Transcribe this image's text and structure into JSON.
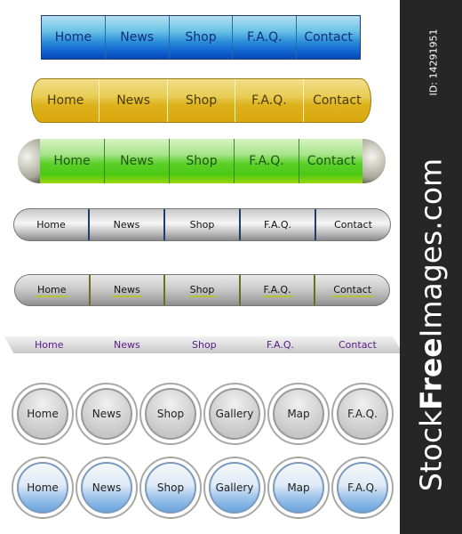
{
  "bars": {
    "blue": [
      "Home",
      "News",
      "Shop",
      "F.A.Q.",
      "Contact"
    ],
    "yellow": [
      "Home",
      "News",
      "Shop",
      "F.A.Q.",
      "Contact"
    ],
    "green": [
      "Home",
      "News",
      "Shop",
      "F.A.Q.",
      "Contact"
    ],
    "silver": [
      "Home",
      "News",
      "Shop",
      "F.A.Q.",
      "Contact"
    ],
    "grey": [
      "Home",
      "News",
      "Shop",
      "F.A.Q.",
      "Contact"
    ],
    "tabs": [
      "Home",
      "News",
      "Shop",
      "F.A.Q.",
      "Contact"
    ]
  },
  "circles": {
    "grey": [
      "Home",
      "News",
      "Shop",
      "Gallery",
      "Map",
      "F.A.Q."
    ],
    "blue": [
      "Home",
      "News",
      "Shop",
      "Gallery",
      "Map",
      "F.A.Q."
    ]
  },
  "watermark": {
    "brand_prefix": "Stock",
    "brand_bold": "Free",
    "brand_suffix": "Images.com",
    "id": "ID: 14291951"
  },
  "colors": {
    "blue_bar": "#0d5fd0",
    "yellow_bar": "#ddb21e",
    "green_bar": "#5cd02a",
    "tab_text": "#5a1a8a",
    "watermark_bg": "#262626"
  }
}
